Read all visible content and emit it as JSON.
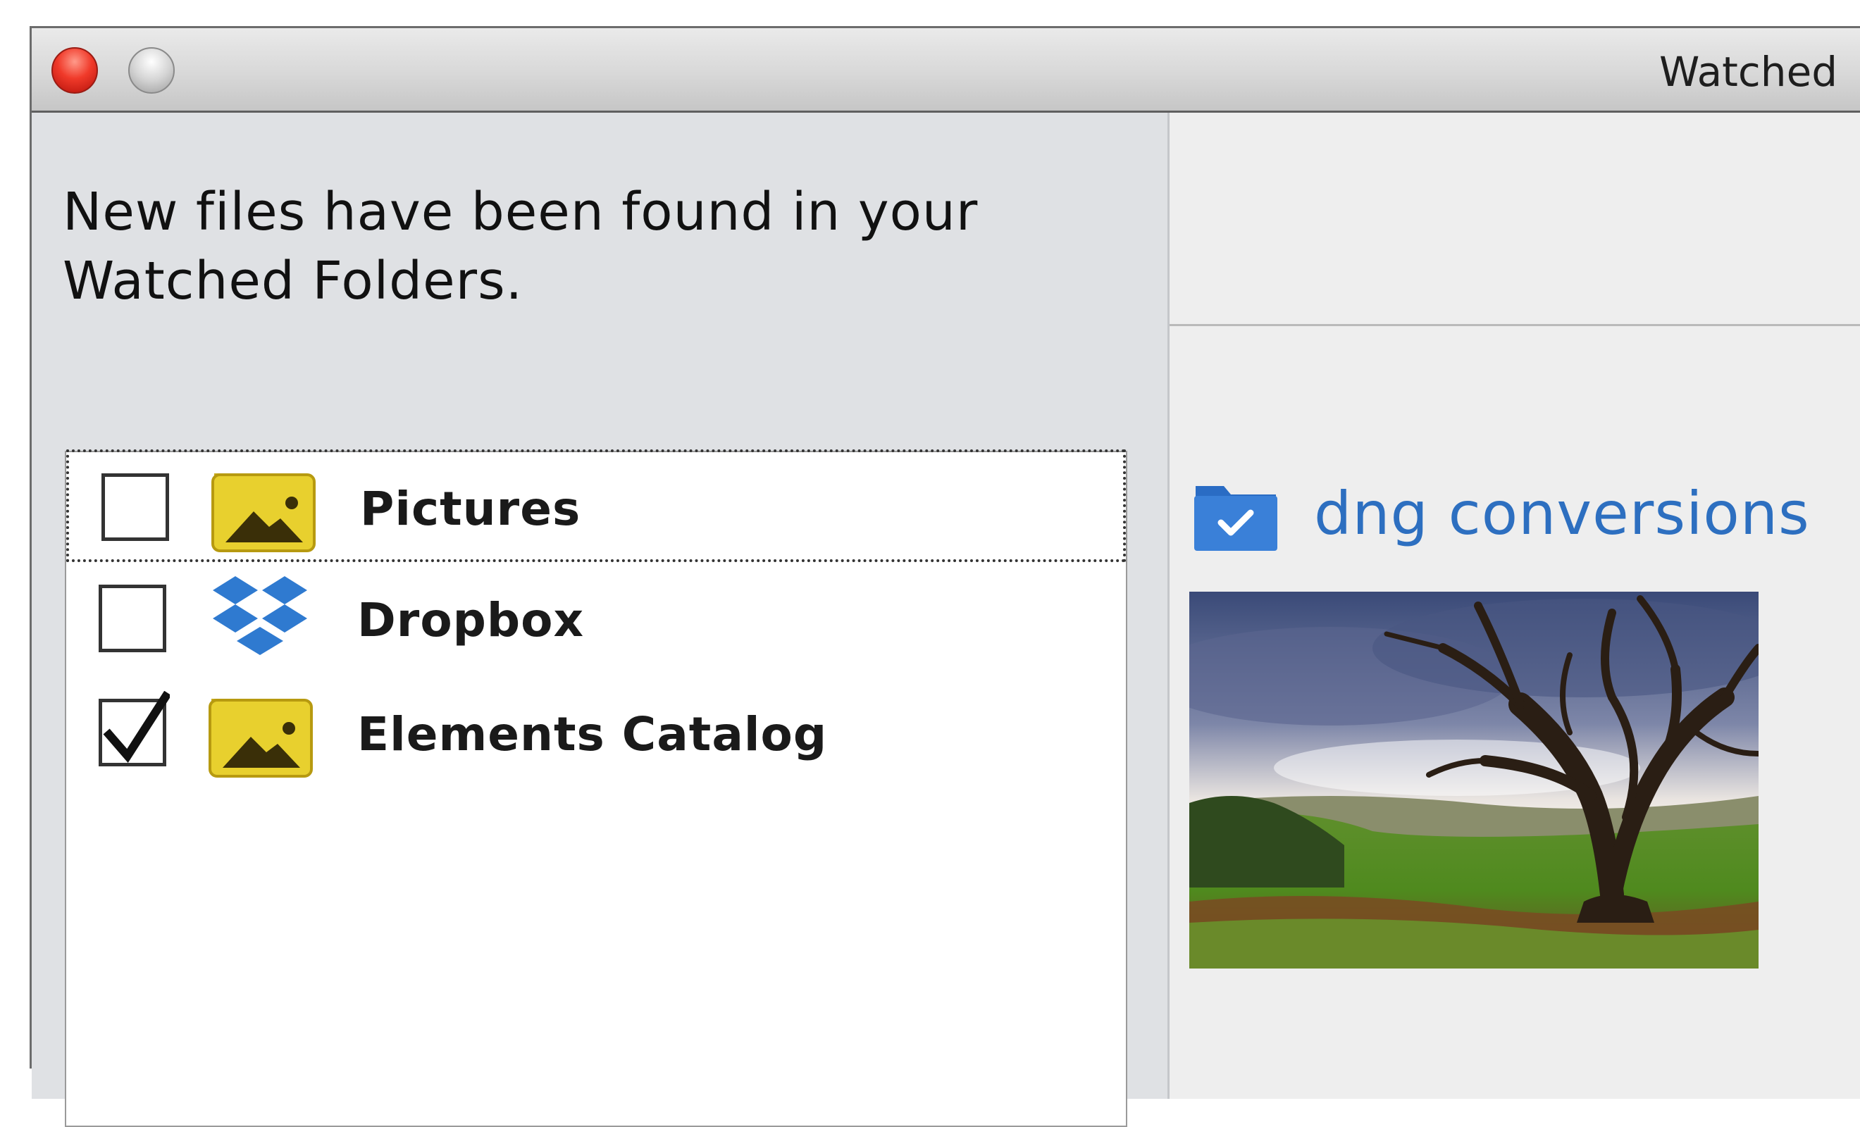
{
  "window": {
    "title": "Watched"
  },
  "message": "New files have been found in your Watched Folders.",
  "folders": [
    {
      "label": "Pictures",
      "checked": false,
      "icon": "picture-folder-icon"
    },
    {
      "label": "Dropbox",
      "checked": false,
      "icon": "dropbox-icon"
    },
    {
      "label": "Elements Catalog",
      "checked": true,
      "icon": "picture-folder-icon"
    }
  ],
  "destination": {
    "label": "dng conversions",
    "icon": "folder-check-icon"
  },
  "colors": {
    "accent": "#2d6fc0",
    "folder_yellow": "#e8d02e"
  }
}
